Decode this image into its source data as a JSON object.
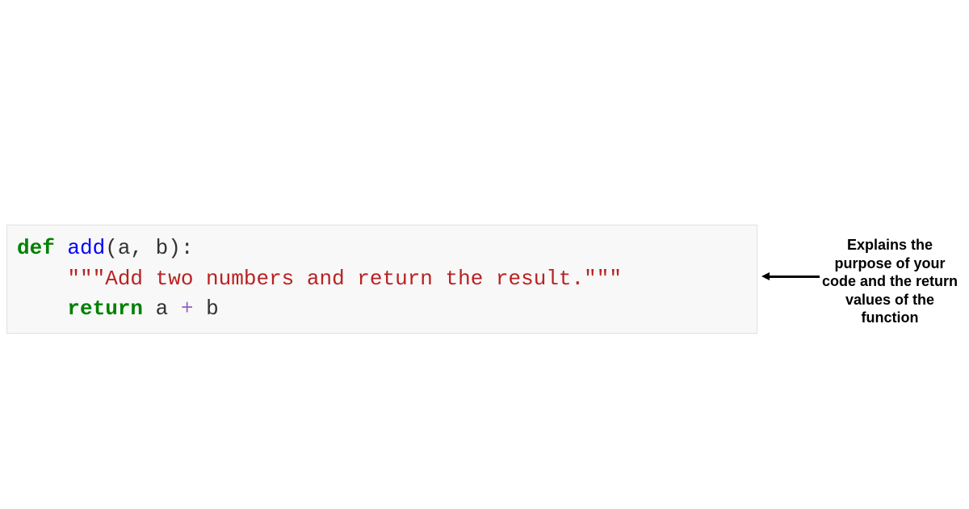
{
  "code": {
    "line1": {
      "def": "def",
      "sp1": " ",
      "fn": "add",
      "open": "(",
      "args": "a, b",
      "close": "):"
    },
    "line2": {
      "indent": "    ",
      "docstring": "\"\"\"Add two numbers and return the result.\"\"\""
    },
    "line3": {
      "indent": "    ",
      "ret": "return",
      "sp": " ",
      "a": "a ",
      "plus": "+",
      "b": " b"
    }
  },
  "annotation": {
    "text": "Explains the purpose of your code and the return values of the function"
  }
}
